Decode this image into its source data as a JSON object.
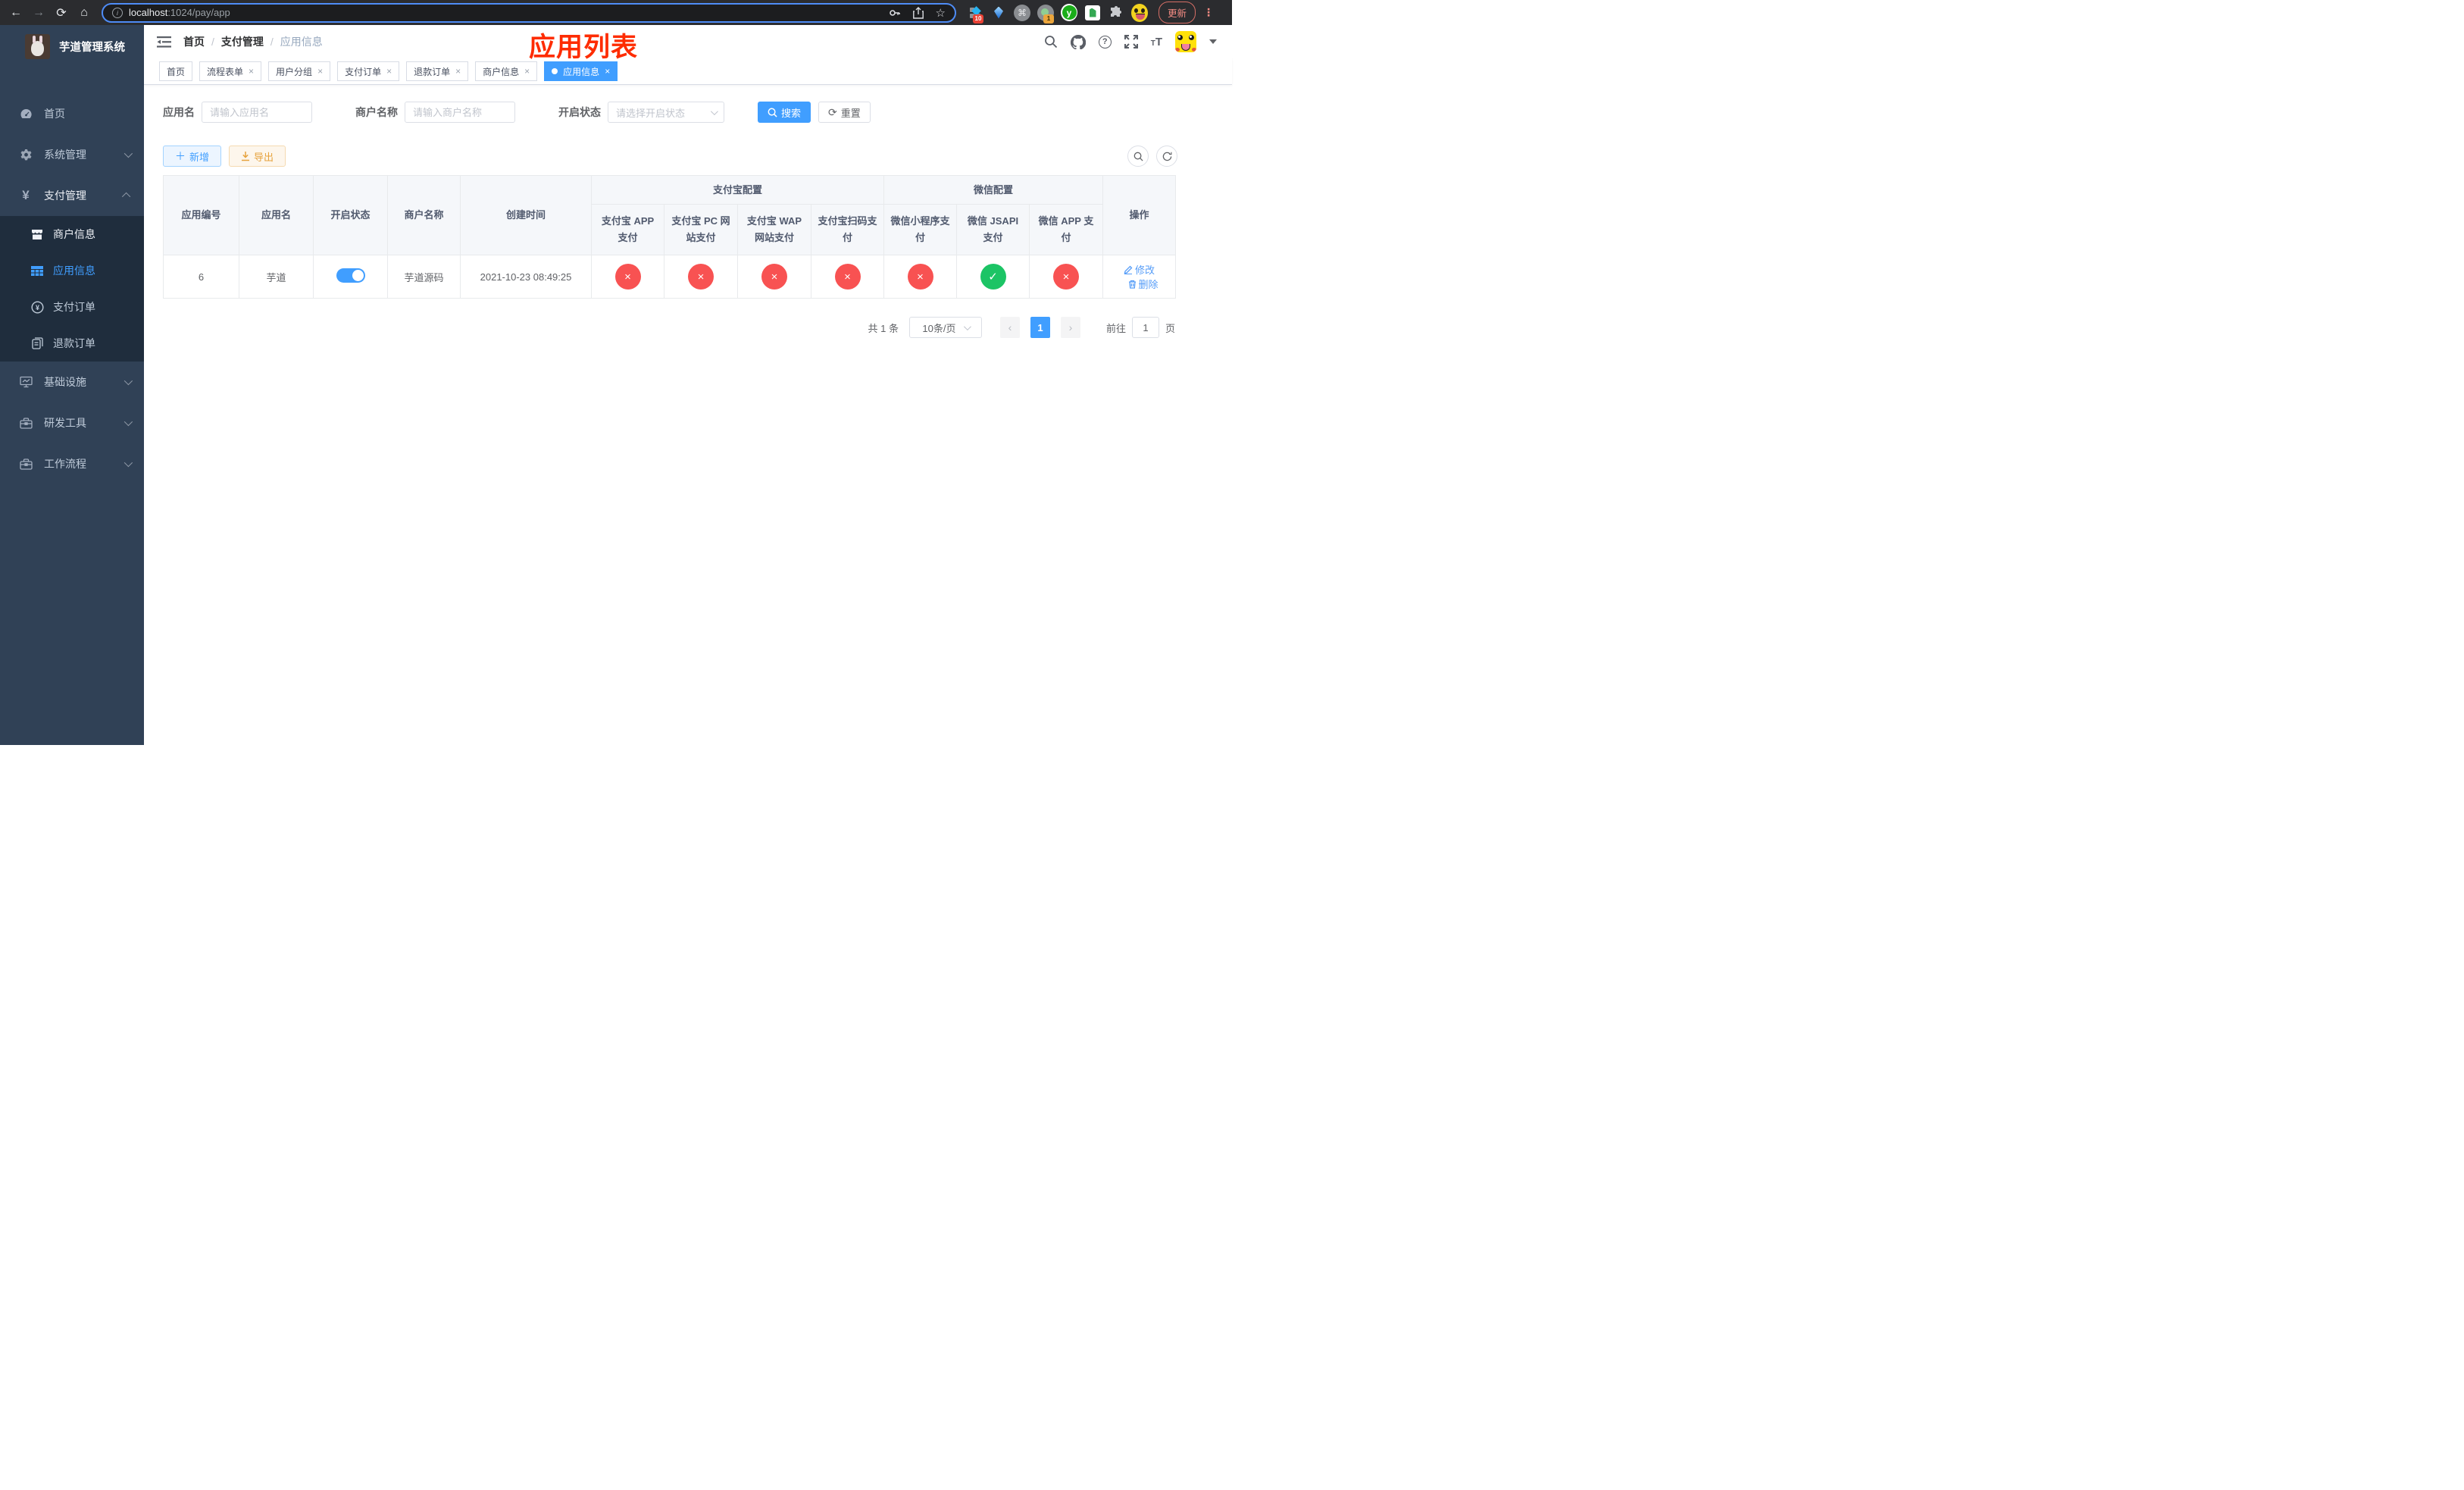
{
  "browser": {
    "url_host": "localhost",
    "url_path": ":1024/pay/app",
    "ext_badge_grid": "10",
    "ext_badge_cam": "1",
    "ext_y_letter": "y",
    "update_label": "更新"
  },
  "sidebar": {
    "logo_title": "芋道管理系统",
    "items": [
      {
        "label": "首页"
      },
      {
        "label": "系统管理"
      },
      {
        "label": "支付管理"
      }
    ],
    "sub_items": [
      {
        "label": "商户信息"
      },
      {
        "label": "应用信息",
        "active": true
      },
      {
        "label": "支付订单"
      },
      {
        "label": "退款订单"
      }
    ],
    "items_bottom": [
      {
        "label": "基础设施"
      },
      {
        "label": "研发工具"
      },
      {
        "label": "工作流程"
      }
    ]
  },
  "header": {
    "breadcrumb": [
      "首页",
      "支付管理",
      "应用信息"
    ],
    "breadcrumb_sep": "/",
    "annotation": "应用列表"
  },
  "tabs": [
    {
      "label": "首页"
    },
    {
      "label": "流程表单"
    },
    {
      "label": "用户分组"
    },
    {
      "label": "支付订单"
    },
    {
      "label": "退款订单"
    },
    {
      "label": "商户信息"
    },
    {
      "label": "应用信息",
      "active": true
    }
  ],
  "filters": {
    "app_name_label": "应用名",
    "app_name_placeholder": "请输入应用名",
    "merchant_label": "商户名称",
    "merchant_placeholder": "请输入商户名称",
    "status_label": "开启状态",
    "status_placeholder": "请选择开启状态",
    "search_label": "搜索",
    "reset_label": "重置"
  },
  "toolbar": {
    "add_label": "新增",
    "export_label": "导出"
  },
  "table": {
    "group_alipay": "支付宝配置",
    "group_wechat": "微信配置",
    "col_id": "应用编号",
    "col_name": "应用名",
    "col_status": "开启状态",
    "col_merchant": "商户名称",
    "col_created": "创建时间",
    "col_alipay_app": "支付宝 APP 支付",
    "col_alipay_pc": "支付宝 PC 网站支付",
    "col_alipay_wap": "支付宝 WAP 网站支付",
    "col_alipay_qr": "支付宝扫码支付",
    "col_wx_mini": "微信小程序支付",
    "col_wx_jsapi": "微信 JSAPI 支付",
    "col_wx_app": "微信 APP 支付",
    "col_ops": "操作",
    "rows": [
      {
        "id": "6",
        "name": "芋道",
        "enabled": true,
        "merchant": "芋道源码",
        "created": "2021-10-23 08:49:25",
        "alipay_app": false,
        "alipay_pc": false,
        "alipay_wap": false,
        "alipay_qr": false,
        "wx_mini": false,
        "wx_jsapi": true,
        "wx_app": false,
        "edit_label": "修改",
        "delete_label": "删除"
      }
    ]
  },
  "pagination": {
    "total_text": "共 1 条",
    "page_size": "10条/页",
    "current_page": "1",
    "goto_label": "前往",
    "goto_value": "1",
    "page_unit": "页"
  },
  "colors": {
    "accent": "#409eff",
    "sidebar_bg": "#304156",
    "submenu_bg": "#1f2d3d",
    "danger_circle": "#f85252",
    "success_circle": "#1cc465",
    "annotation_red": "#fe2c00",
    "export_warning": "#e6a23c"
  }
}
